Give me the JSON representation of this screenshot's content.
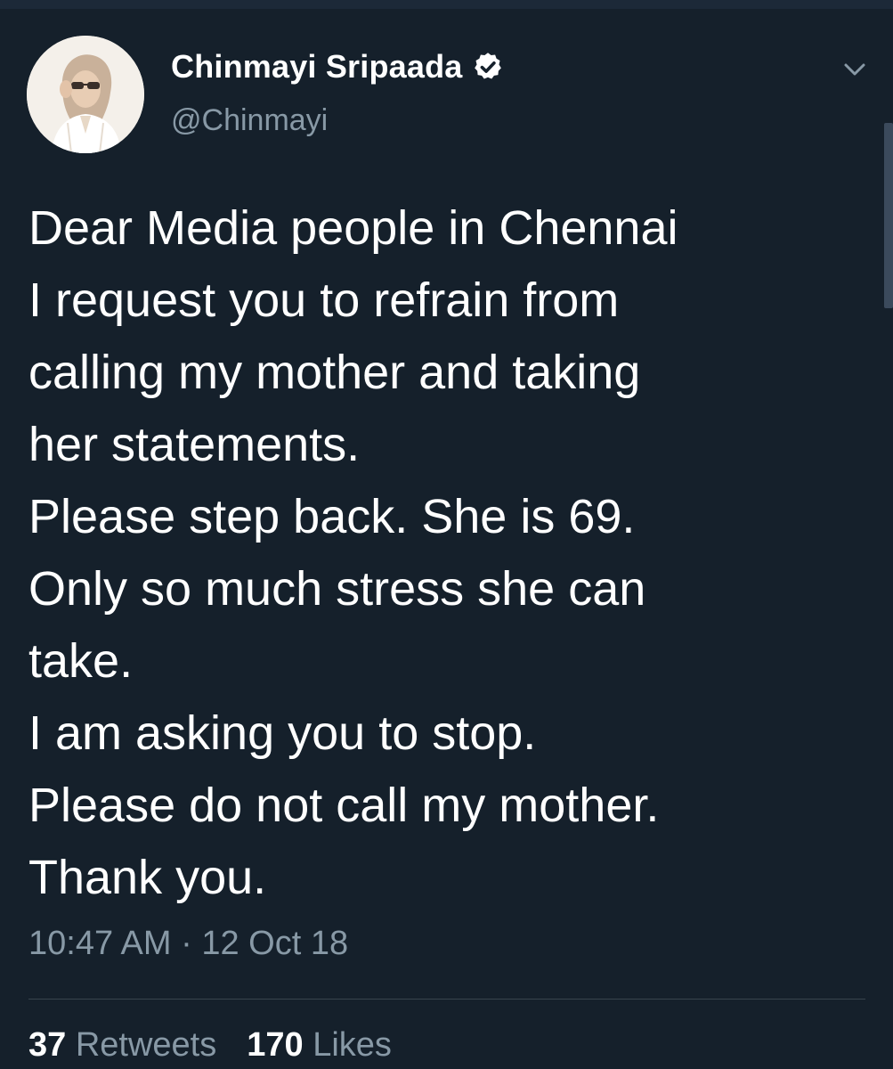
{
  "tweet": {
    "author": {
      "display_name": "Chinmayi Sripaada",
      "handle": "@Chinmayi",
      "verified_icon": "verified-badge-icon",
      "avatar_icon": "profile-photo"
    },
    "menu_icon": "chevron-down-icon",
    "text_lines": [
      "Dear Media people in Chennai",
      "I request you to refrain from",
      "calling my mother and taking",
      "her statements.",
      "Please step back. She is 69.",
      "Only so much stress she can",
      "take.",
      "I am asking you to stop.",
      "Please do not call my mother.",
      "Thank you."
    ],
    "timestamp": "10:47 AM · 12 Oct 18",
    "stats": {
      "retweets_count": "37",
      "retweets_label": "Retweets",
      "likes_count": "170",
      "likes_label": "Likes"
    }
  },
  "colors": {
    "background": "#15202b",
    "primary_text": "#ffffff",
    "secondary_text": "#8899a6",
    "divider": "#38444d"
  }
}
